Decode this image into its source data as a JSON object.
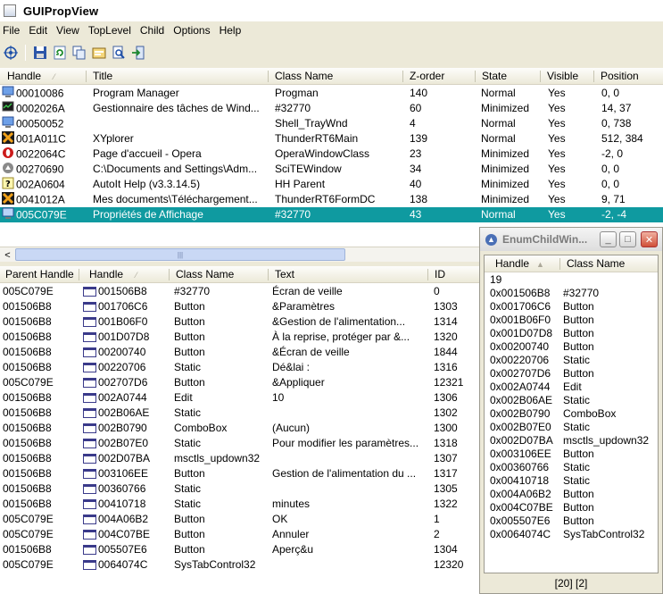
{
  "window": {
    "title": "GUIPropView"
  },
  "menu": [
    "File",
    "Edit",
    "View",
    "TopLevel",
    "Child",
    "Options",
    "Help"
  ],
  "toolbar": {
    "icons": [
      "crosshair-icon",
      "save-icon",
      "refresh-icon",
      "copy-icon",
      "properties-icon",
      "find-icon",
      "exit-icon"
    ]
  },
  "top_table": {
    "columns": [
      "Handle",
      "Title",
      "Class Name",
      "Z-order",
      "State",
      "Visible",
      "Position"
    ],
    "sorted_column": "Handle",
    "rows": [
      {
        "icon": "program-manager-icon",
        "handle": "00010086",
        "title": "Program Manager",
        "class_name": "Progman",
        "zorder": "140",
        "state": "Normal",
        "visible": "Yes",
        "position": "0, 0"
      },
      {
        "icon": "task-manager-icon",
        "handle": "0002026A",
        "title": "Gestionnaire des tâches de Wind...",
        "class_name": "#32770",
        "zorder": "60",
        "state": "Minimized",
        "visible": "Yes",
        "position": "14, 37"
      },
      {
        "icon": "program-manager-icon",
        "handle": "00050052",
        "title": "",
        "class_name": "Shell_TrayWnd",
        "zorder": "4",
        "state": "Normal",
        "visible": "Yes",
        "position": "0, 738"
      },
      {
        "icon": "xyplorer-icon",
        "handle": "001A011C",
        "title": "XYplorer",
        "class_name": "ThunderRT6Main",
        "zorder": "139",
        "state": "Normal",
        "visible": "Yes",
        "position": "512, 384"
      },
      {
        "icon": "opera-icon",
        "handle": "0022064C",
        "title": "Page d'accueil - Opera",
        "class_name": "OperaWindowClass",
        "zorder": "23",
        "state": "Minimized",
        "visible": "Yes",
        "position": "-2, 0"
      },
      {
        "icon": "scite-icon",
        "handle": "00270690",
        "title": "C:\\Documents and Settings\\Adm...",
        "class_name": "SciTEWindow",
        "zorder": "34",
        "state": "Minimized",
        "visible": "Yes",
        "position": "0, 0"
      },
      {
        "icon": "help-icon",
        "handle": "002A0604",
        "title": "AutoIt Help (v3.3.14.5)",
        "class_name": "HH Parent",
        "zorder": "40",
        "state": "Minimized",
        "visible": "Yes",
        "position": "0, 0"
      },
      {
        "icon": "xyplorer-icon",
        "handle": "0041012A",
        "title": "Mes documents\\Téléchargement...",
        "class_name": "ThunderRT6FormDC",
        "zorder": "138",
        "state": "Minimized",
        "visible": "Yes",
        "position": "9, 71"
      },
      {
        "icon": "display-properties-icon",
        "handle": "005C079E",
        "title": "Propriétés de Affichage",
        "class_name": "#32770",
        "zorder": "43",
        "state": "Normal",
        "visible": "Yes",
        "position": "-2, -4"
      }
    ],
    "selected_row": 8
  },
  "bottom_table": {
    "columns": [
      "Parent Handle",
      "Handle",
      "Class Name",
      "Text",
      "ID"
    ],
    "sorted_column": "Handle",
    "rows": [
      {
        "parent": "005C079E",
        "handle": "001506B8",
        "class_name": "#32770",
        "text": "Écran de veille",
        "id": "0"
      },
      {
        "parent": "001506B8",
        "handle": "001706C6",
        "class_name": "Button",
        "text": "&Paramètres",
        "id": "1303"
      },
      {
        "parent": "001506B8",
        "handle": "001B06F0",
        "class_name": "Button",
        "text": "&Gestion de l'alimentation...",
        "id": "1314"
      },
      {
        "parent": "001506B8",
        "handle": "001D07D8",
        "class_name": "Button",
        "text": "À la reprise, protéger par &...",
        "id": "1320"
      },
      {
        "parent": "001506B8",
        "handle": "00200740",
        "class_name": "Button",
        "text": "&Écran de veille",
        "id": "1844"
      },
      {
        "parent": "001506B8",
        "handle": "00220706",
        "class_name": "Static",
        "text": "Dé&lai :",
        "id": "1316"
      },
      {
        "parent": "005C079E",
        "handle": "002707D6",
        "class_name": "Button",
        "text": "&Appliquer",
        "id": "12321"
      },
      {
        "parent": "001506B8",
        "handle": "002A0744",
        "class_name": "Edit",
        "text": "10",
        "id": "1306"
      },
      {
        "parent": "001506B8",
        "handle": "002B06AE",
        "class_name": "Static",
        "text": "",
        "id": "1302"
      },
      {
        "parent": "001506B8",
        "handle": "002B0790",
        "class_name": "ComboBox",
        "text": "(Aucun)",
        "id": "1300"
      },
      {
        "parent": "001506B8",
        "handle": "002B07E0",
        "class_name": "Static",
        "text": "Pour modifier les paramètres...",
        "id": "1318"
      },
      {
        "parent": "001506B8",
        "handle": "002D07BA",
        "class_name": "msctls_updown32",
        "text": "",
        "id": "1307"
      },
      {
        "parent": "001506B8",
        "handle": "003106EE",
        "class_name": "Button",
        "text": "Gestion de l'alimentation du ...",
        "id": "1317"
      },
      {
        "parent": "001506B8",
        "handle": "00360766",
        "class_name": "Static",
        "text": "",
        "id": "1305"
      },
      {
        "parent": "001506B8",
        "handle": "00410718",
        "class_name": "Static",
        "text": "minutes",
        "id": "1322"
      },
      {
        "parent": "005C079E",
        "handle": "004A06B2",
        "class_name": "Button",
        "text": "OK",
        "id": "1"
      },
      {
        "parent": "005C079E",
        "handle": "004C07BE",
        "class_name": "Button",
        "text": "Annuler",
        "id": "2"
      },
      {
        "parent": "001506B8",
        "handle": "005507E6",
        "class_name": "Button",
        "text": "Aperç&u",
        "id": "1304"
      },
      {
        "parent": "005C079E",
        "handle": "0064074C",
        "class_name": "SysTabControl32",
        "text": "",
        "id": "12320"
      }
    ]
  },
  "popup": {
    "title": "EnumChildWin...",
    "columns": [
      "Handle",
      "Class Name"
    ],
    "rows": [
      {
        "handle": "19",
        "class_name": ""
      },
      {
        "handle": "0x001506B8",
        "class_name": "#32770"
      },
      {
        "handle": "0x001706C6",
        "class_name": "Button"
      },
      {
        "handle": "0x001B06F0",
        "class_name": "Button"
      },
      {
        "handle": "0x001D07D8",
        "class_name": "Button"
      },
      {
        "handle": "0x00200740",
        "class_name": "Button"
      },
      {
        "handle": "0x00220706",
        "class_name": "Static"
      },
      {
        "handle": "0x002707D6",
        "class_name": "Button"
      },
      {
        "handle": "0x002A0744",
        "class_name": "Edit"
      },
      {
        "handle": "0x002B06AE",
        "class_name": "Static"
      },
      {
        "handle": "0x002B0790",
        "class_name": "ComboBox"
      },
      {
        "handle": "0x002B07E0",
        "class_name": "Static"
      },
      {
        "handle": "0x002D07BA",
        "class_name": "msctls_updown32"
      },
      {
        "handle": "0x003106EE",
        "class_name": "Button"
      },
      {
        "handle": "0x00360766",
        "class_name": "Static"
      },
      {
        "handle": "0x00410718",
        "class_name": "Static"
      },
      {
        "handle": "0x004A06B2",
        "class_name": "Button"
      },
      {
        "handle": "0x004C07BE",
        "class_name": "Button"
      },
      {
        "handle": "0x005507E6",
        "class_name": "Button"
      },
      {
        "handle": "0x0064074C",
        "class_name": "SysTabControl32"
      }
    ],
    "status": "[20] [2]"
  },
  "colors": {
    "selection": "#0f9aa0",
    "background": "#ece9d8"
  }
}
